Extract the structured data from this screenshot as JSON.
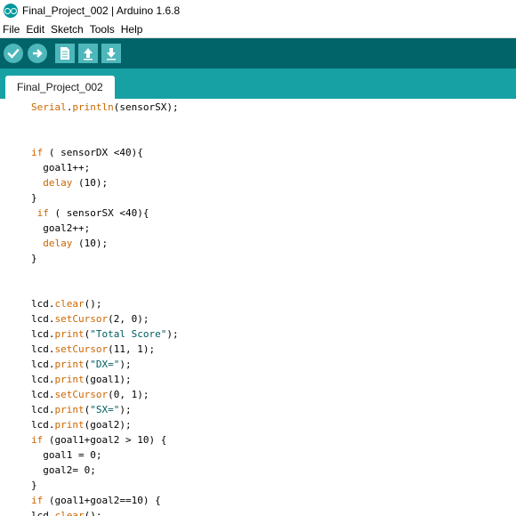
{
  "window": {
    "title": "Final_Project_002 | Arduino 1.6.8",
    "logo_icon": "arduino-logo-icon"
  },
  "menu": {
    "items": [
      "File",
      "Edit",
      "Sketch",
      "Tools",
      "Help"
    ]
  },
  "toolbar": {
    "buttons": [
      {
        "name": "verify-button",
        "icon": "checkmark-icon"
      },
      {
        "name": "upload-button",
        "icon": "arrow-right-icon"
      },
      {
        "name": "new-button",
        "icon": "document-icon"
      },
      {
        "name": "open-button",
        "icon": "arrow-up-icon"
      },
      {
        "name": "save-button",
        "icon": "arrow-down-icon"
      }
    ]
  },
  "tabs": [
    {
      "label": "Final_Project_002",
      "active": true
    }
  ],
  "colors": {
    "toolbar_bg": "#006468",
    "tabstrip_bg": "#17a1a5",
    "button_bg": "#4db7bb",
    "keyword_orange": "#cc6600",
    "keyword_teal": "#00979c"
  },
  "code": {
    "lines": [
      [
        {
          "t": "Serial",
          "c": "o"
        },
        {
          "t": ".",
          "c": ""
        },
        {
          "t": "println",
          "c": "o"
        },
        {
          "t": "(sensorSX);",
          "c": ""
        }
      ],
      [],
      [],
      [
        {
          "t": "if",
          "c": "o"
        },
        {
          "t": " ( sensorDX <40){",
          "c": ""
        }
      ],
      [
        {
          "t": "  goal1++;",
          "c": ""
        }
      ],
      [
        {
          "t": "  ",
          "c": ""
        },
        {
          "t": "delay",
          "c": "o"
        },
        {
          "t": " (10);",
          "c": ""
        }
      ],
      [
        {
          "t": "}",
          "c": ""
        }
      ],
      [
        {
          "t": " ",
          "c": ""
        },
        {
          "t": "if",
          "c": "o"
        },
        {
          "t": " ( sensorSX <40){",
          "c": ""
        }
      ],
      [
        {
          "t": "  goal2++;",
          "c": ""
        }
      ],
      [
        {
          "t": "  ",
          "c": ""
        },
        {
          "t": "delay",
          "c": "o"
        },
        {
          "t": " (10);",
          "c": ""
        }
      ],
      [
        {
          "t": "}",
          "c": ""
        }
      ],
      [],
      [],
      [
        {
          "t": "lcd.",
          "c": ""
        },
        {
          "t": "clear",
          "c": "o"
        },
        {
          "t": "();",
          "c": ""
        }
      ],
      [
        {
          "t": "lcd.",
          "c": ""
        },
        {
          "t": "setCursor",
          "c": "o"
        },
        {
          "t": "(2, 0);",
          "c": ""
        }
      ],
      [
        {
          "t": "lcd.",
          "c": ""
        },
        {
          "t": "print",
          "c": "o"
        },
        {
          "t": "(",
          "c": ""
        },
        {
          "t": "\"Total Score\"",
          "c": "s"
        },
        {
          "t": ");",
          "c": ""
        }
      ],
      [
        {
          "t": "lcd.",
          "c": ""
        },
        {
          "t": "setCursor",
          "c": "o"
        },
        {
          "t": "(11, 1);",
          "c": ""
        }
      ],
      [
        {
          "t": "lcd.",
          "c": ""
        },
        {
          "t": "print",
          "c": "o"
        },
        {
          "t": "(",
          "c": ""
        },
        {
          "t": "\"DX=\"",
          "c": "s"
        },
        {
          "t": ");",
          "c": ""
        }
      ],
      [
        {
          "t": "lcd.",
          "c": ""
        },
        {
          "t": "print",
          "c": "o"
        },
        {
          "t": "(goal1);",
          "c": ""
        }
      ],
      [
        {
          "t": "lcd.",
          "c": ""
        },
        {
          "t": "setCursor",
          "c": "o"
        },
        {
          "t": "(0, 1);",
          "c": ""
        }
      ],
      [
        {
          "t": "lcd.",
          "c": ""
        },
        {
          "t": "print",
          "c": "o"
        },
        {
          "t": "(",
          "c": ""
        },
        {
          "t": "\"SX=\"",
          "c": "s"
        },
        {
          "t": ");",
          "c": ""
        }
      ],
      [
        {
          "t": "lcd.",
          "c": ""
        },
        {
          "t": "print",
          "c": "o"
        },
        {
          "t": "(goal2);",
          "c": ""
        }
      ],
      [
        {
          "t": "if",
          "c": "o"
        },
        {
          "t": " (goal1+goal2 > 10) {",
          "c": ""
        }
      ],
      [
        {
          "t": "  goal1 = 0;",
          "c": ""
        }
      ],
      [
        {
          "t": "  goal2= 0;",
          "c": ""
        }
      ],
      [
        {
          "t": "}",
          "c": ""
        }
      ],
      [
        {
          "t": "if",
          "c": "o"
        },
        {
          "t": " (goal1+goal2==10) {",
          "c": ""
        }
      ],
      [
        {
          "t": "lcd.",
          "c": ""
        },
        {
          "t": "clear",
          "c": "o"
        },
        {
          "t": "();",
          "c": ""
        }
      ]
    ]
  }
}
